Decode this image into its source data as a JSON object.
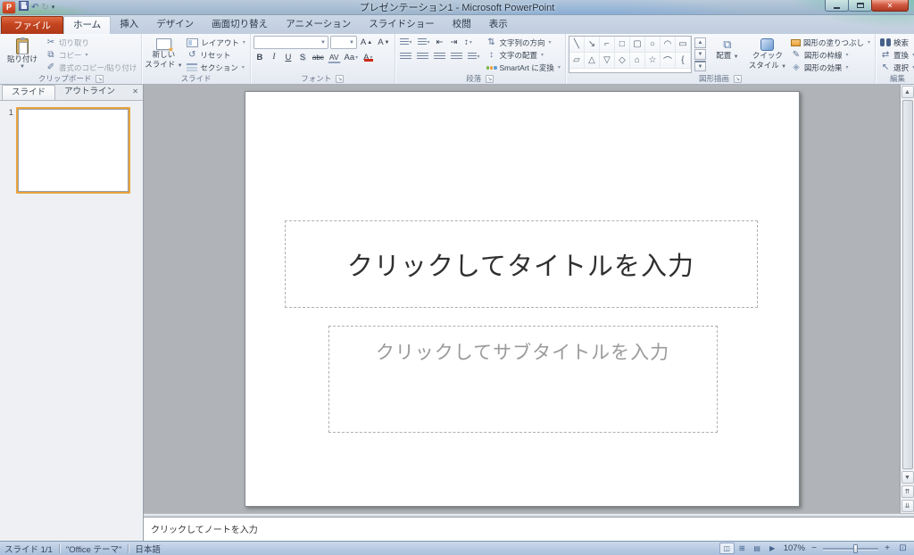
{
  "colors": {
    "file_tab": "#c2431f",
    "title_glass_accent": "#9cb4cc",
    "status_bar": "#a9bfdc",
    "thumbnail_selection": "#e8a33d",
    "app_icon": "#bf3a1c"
  },
  "window": {
    "title": "プレゼンテーション1 - Microsoft PowerPoint"
  },
  "tabs": {
    "file": "ファイル",
    "items": [
      "ホーム",
      "挿入",
      "デザイン",
      "画面切り替え",
      "アニメーション",
      "スライドショー",
      "校閲",
      "表示"
    ],
    "active": "ホーム"
  },
  "ribbon": {
    "clipboard": {
      "label": "クリップボード",
      "paste": "貼り付け",
      "cut": "切り取り",
      "copy": "コピー",
      "format_painter": "書式のコピー/貼り付け"
    },
    "slides": {
      "label": "スライド",
      "new_slide_line1": "新しい",
      "new_slide_line2": "スライド",
      "layout": "レイアウト",
      "reset": "リセット",
      "section": "セクション"
    },
    "font": {
      "label": "フォント",
      "font_name": "",
      "font_size": "",
      "bold": "B",
      "italic": "I",
      "underline": "U",
      "shadow": "S",
      "strikethrough": "abc",
      "spacing": "AV",
      "case": "Aa",
      "color": "A",
      "grow": "A",
      "shrink": "A"
    },
    "paragraph": {
      "label": "段落",
      "text_direction": "文字列の方向",
      "align_text": "文字の配置",
      "smartart": "SmartArt に変換"
    },
    "drawing": {
      "label": "図形描画",
      "arrange": "配置",
      "quick_styles_line1": "クイック",
      "quick_styles_line2": "スタイル",
      "shape_fill": "図形の塗りつぶし",
      "shape_outline": "図形の枠線",
      "shape_effects": "図形の効果",
      "shape_gallery_row1": [
        "line",
        "arrow",
        "elbow-connector",
        "rectangle",
        "rounded-rectangle",
        "oval",
        "arc",
        "text-box"
      ],
      "shape_gallery_row2": [
        "parallelogram",
        "triangle",
        "down-triangle",
        "diamond",
        "home",
        "star",
        "curve",
        "brace"
      ]
    },
    "editing": {
      "label": "編集",
      "find": "検索",
      "replace": "置換",
      "select": "選択"
    }
  },
  "left_panel": {
    "slides_tab": "スライド",
    "outline_tab": "アウトライン",
    "slide_number": "1"
  },
  "slide": {
    "title_placeholder": "クリックしてタイトルを入力",
    "subtitle_placeholder": "クリックしてサブタイトルを入力"
  },
  "notes": {
    "placeholder": "クリックしてノートを入力"
  },
  "status_bar": {
    "slide_indicator": "スライド 1/1",
    "theme": "\"Office テーマ\"",
    "language": "日本語",
    "view_buttons": [
      "normal-view",
      "slide-sorter",
      "reading-view",
      "slide-show"
    ],
    "zoom": "107%"
  }
}
